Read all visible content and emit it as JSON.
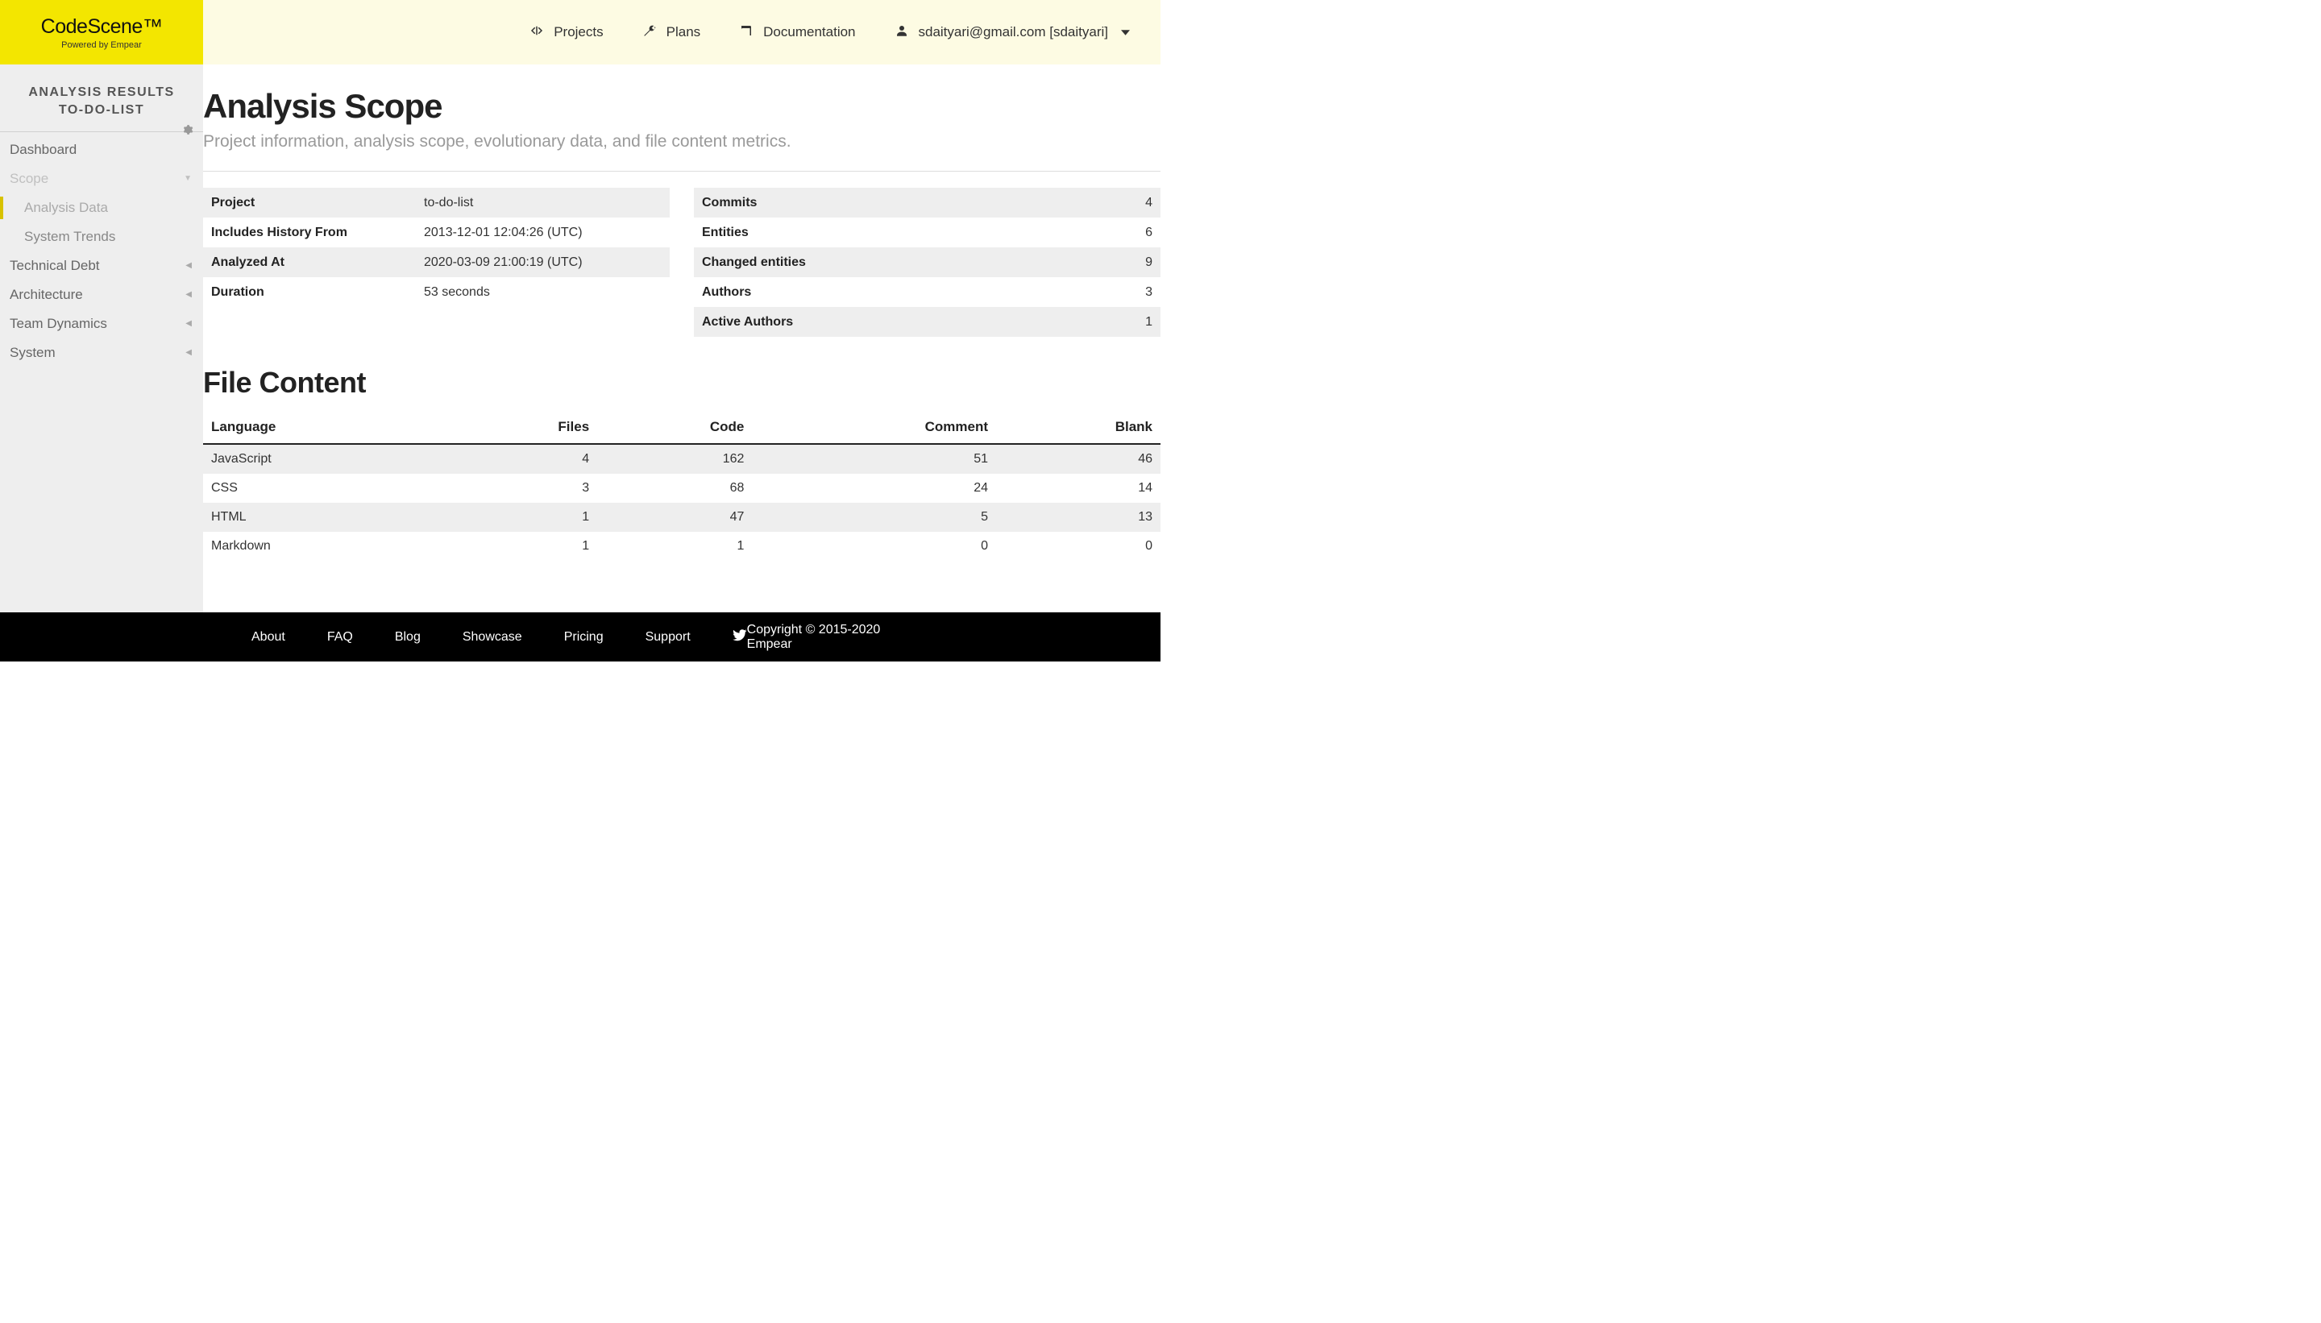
{
  "logo": {
    "main": "CodeScene™",
    "sub": "Powered by Empear"
  },
  "nav": {
    "projects": "Projects",
    "plans": "Plans",
    "documentation": "Documentation",
    "user": "sdaityari@gmail.com [sdaityari]"
  },
  "sidebar": {
    "title1": "ANALYSIS RESULTS",
    "title2": "TO-DO-LIST",
    "dashboard": "Dashboard",
    "scope": "Scope",
    "analysis_data": "Analysis Data",
    "system_trends": "System Trends",
    "technical_debt": "Technical Debt",
    "architecture": "Architecture",
    "team_dynamics": "Team Dynamics",
    "system": "System"
  },
  "page": {
    "title": "Analysis Scope",
    "subtitle": "Project information, analysis scope, evolutionary data, and file content metrics."
  },
  "info_left": [
    {
      "label": "Project",
      "value": "to-do-list"
    },
    {
      "label": "Includes History From",
      "value": "2013-12-01 12:04:26 (UTC)"
    },
    {
      "label": "Analyzed At",
      "value": "2020-03-09 21:00:19 (UTC)"
    },
    {
      "label": "Duration",
      "value": "53 seconds"
    }
  ],
  "info_right": [
    {
      "label": "Commits",
      "value": "4"
    },
    {
      "label": "Entities",
      "value": "6"
    },
    {
      "label": "Changed entities",
      "value": "9"
    },
    {
      "label": "Authors",
      "value": "3"
    },
    {
      "label": "Active Authors",
      "value": "1"
    }
  ],
  "file_section_title": "File Content",
  "file_headers": {
    "lang": "Language",
    "files": "Files",
    "code": "Code",
    "comment": "Comment",
    "blank": "Blank"
  },
  "file_rows": [
    {
      "lang": "JavaScript",
      "files": "4",
      "code": "162",
      "comment": "51",
      "blank": "46"
    },
    {
      "lang": "CSS",
      "files": "3",
      "code": "68",
      "comment": "24",
      "blank": "14"
    },
    {
      "lang": "HTML",
      "files": "1",
      "code": "47",
      "comment": "5",
      "blank": "13"
    },
    {
      "lang": "Markdown",
      "files": "1",
      "code": "1",
      "comment": "0",
      "blank": "0"
    }
  ],
  "footer": {
    "links": [
      "About",
      "FAQ",
      "Blog",
      "Showcase",
      "Pricing",
      "Support"
    ],
    "copyright": "Copyright © 2015-2020 Empear"
  }
}
